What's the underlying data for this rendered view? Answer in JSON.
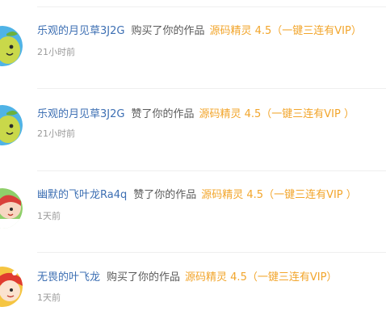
{
  "notifications": [
    {
      "user": "乐观的月见草3J2G",
      "action": "购买了你的作品",
      "work": "源码精灵 4.5（一键三连有VIP）",
      "time": "21小时前",
      "avatar_icon": "pear-mascot-avatar-icon"
    },
    {
      "user": "乐观的月见草3J2G",
      "action": "赞了你的作品",
      "work": "源码精灵 4.5（一键三连有VIP ）",
      "time": "21小时前",
      "avatar_icon": "pear-mascot-avatar-icon"
    },
    {
      "user": "幽默的飞叶龙Ra4q",
      "action": "赞了你的作品",
      "work": "源码精灵 4.5（一键三连有VIP ）",
      "time": "1天前",
      "avatar_icon": "girl-cartoon-avatar-icon"
    },
    {
      "user": "无畏的叶飞龙",
      "action": "购买了你的作品",
      "work": "源码精灵 4.5（一键三连有VIP）",
      "time": "1天前",
      "avatar_icon": "red-hat-cartoon-avatar-icon"
    }
  ],
  "colors": {
    "user_link": "#3d6fb3",
    "work_link": "#f2a52b",
    "action_text": "#5a5a5a",
    "time_text": "#9a9a9a",
    "divider": "#efefef"
  }
}
